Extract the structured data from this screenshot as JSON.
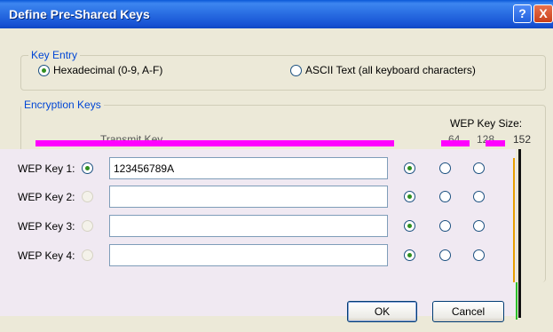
{
  "window": {
    "title": "Define Pre-Shared Keys",
    "help_glyph": "?",
    "close_glyph": "X"
  },
  "key_entry": {
    "label": "Key Entry",
    "hex_label": "Hexadecimal (0-9, A-F)",
    "ascii_label": "ASCII Text (all keyboard characters)",
    "selected": "hex"
  },
  "encryption_keys": {
    "label": "Encryption Keys",
    "key_size_label": "WEP Key Size:",
    "transmit_header": "Transmit Key",
    "size_64": "64",
    "size_128": "128",
    "size_152": "152",
    "rows": [
      {
        "label": "WEP Key 1:",
        "value": "123456789A",
        "transmit": true
      },
      {
        "label": "WEP Key 2:",
        "value": "",
        "transmit": false
      },
      {
        "label": "WEP Key 3:",
        "value": "",
        "transmit": false
      },
      {
        "label": "WEP Key 4:",
        "value": "",
        "transmit": false
      }
    ]
  },
  "buttons": {
    "ok": "OK",
    "cancel": "Cancel"
  },
  "colors": {
    "title_bar": "#2A6FE3",
    "group_label": "#0046D5",
    "radio_selected": "#2F8F1F",
    "magenta_artifact": "#FF00FF"
  }
}
